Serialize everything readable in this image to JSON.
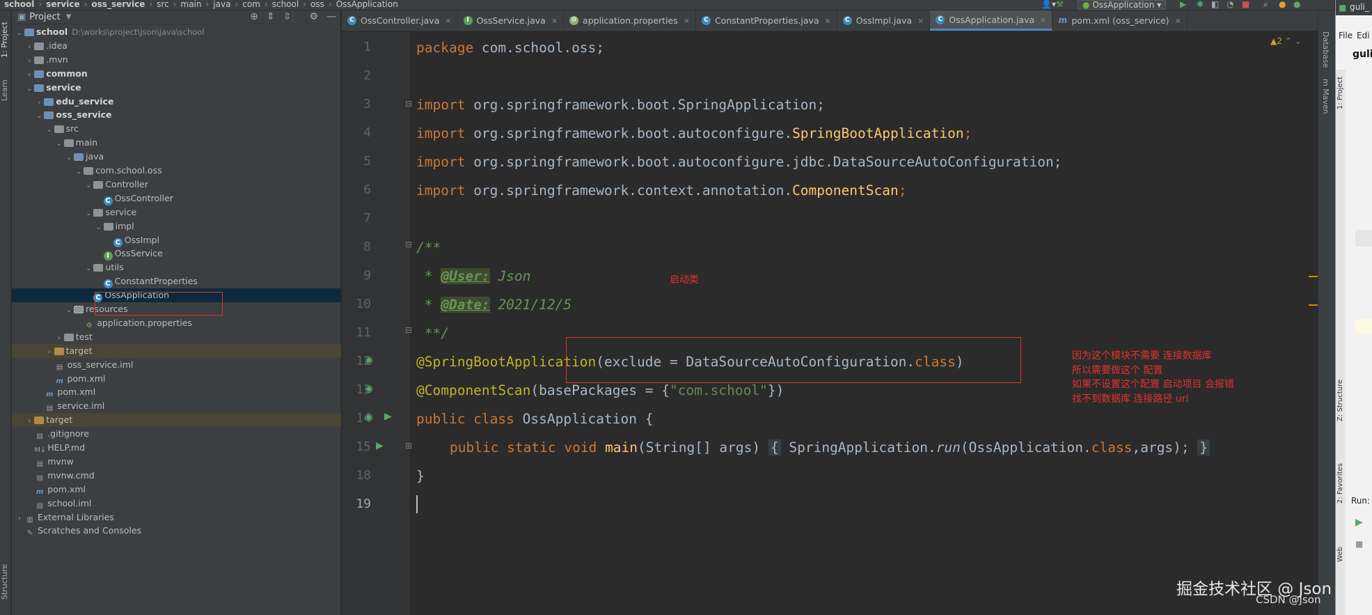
{
  "breadcrumb": [
    "school",
    "service",
    "oss_service",
    "src",
    "main",
    "java",
    "com",
    "school",
    "oss",
    "OssApplication"
  ],
  "run_config": {
    "label": "OssApplication"
  },
  "left_strip": {
    "project": "1: Project",
    "learn": "Learn",
    "structure": "Structure"
  },
  "project_panel": {
    "title": "Project",
    "tree": [
      {
        "label": "school",
        "suffix": "D:\\works\\project\\json\\java\\school",
        "depth": 0,
        "arrow": "down",
        "icon": "folder-blue",
        "bold": true
      },
      {
        "label": ".idea",
        "depth": 1,
        "arrow": "right",
        "icon": "folder"
      },
      {
        "label": ".mvn",
        "depth": 1,
        "arrow": "right",
        "icon": "folder"
      },
      {
        "label": "common",
        "depth": 1,
        "arrow": "right",
        "icon": "folder-blue",
        "bold": true
      },
      {
        "label": "service",
        "depth": 1,
        "arrow": "down",
        "icon": "folder-blue",
        "bold": true
      },
      {
        "label": "edu_service",
        "depth": 2,
        "arrow": "right",
        "icon": "folder-blue",
        "bold": true
      },
      {
        "label": "oss_service",
        "depth": 2,
        "arrow": "down",
        "icon": "folder-blue",
        "bold": true
      },
      {
        "label": "src",
        "depth": 3,
        "arrow": "down",
        "icon": "folder"
      },
      {
        "label": "main",
        "depth": 4,
        "arrow": "down",
        "icon": "folder"
      },
      {
        "label": "java",
        "depth": 5,
        "arrow": "down",
        "icon": "folder-blue"
      },
      {
        "label": "com.school.oss",
        "depth": 6,
        "arrow": "down",
        "icon": "folder"
      },
      {
        "label": "Controller",
        "depth": 7,
        "arrow": "down",
        "icon": "folder"
      },
      {
        "label": "OssController",
        "depth": 8,
        "arrow": "",
        "icon": "class"
      },
      {
        "label": "service",
        "depth": 7,
        "arrow": "down",
        "icon": "folder"
      },
      {
        "label": "impl",
        "depth": 8,
        "arrow": "down",
        "icon": "folder"
      },
      {
        "label": "OssImpl",
        "depth": 9,
        "arrow": "",
        "icon": "class"
      },
      {
        "label": "OssService",
        "depth": 8,
        "arrow": "",
        "icon": "interface"
      },
      {
        "label": "utils",
        "depth": 7,
        "arrow": "down",
        "icon": "folder"
      },
      {
        "label": "ConstantProperties",
        "depth": 8,
        "arrow": "",
        "icon": "class"
      },
      {
        "label": "OssApplication",
        "depth": 7,
        "arrow": "",
        "icon": "spring-class",
        "selected": true
      },
      {
        "label": "resources",
        "depth": 5,
        "arrow": "down",
        "icon": "folder-res"
      },
      {
        "label": "application.properties",
        "depth": 6,
        "arrow": "",
        "icon": "properties"
      },
      {
        "label": "test",
        "depth": 4,
        "arrow": "right",
        "icon": "folder"
      },
      {
        "label": "target",
        "depth": 3,
        "arrow": "right",
        "icon": "folder-orange",
        "target": true
      },
      {
        "label": "oss_service.iml",
        "depth": 3,
        "arrow": "",
        "icon": "file"
      },
      {
        "label": "pom.xml",
        "depth": 3,
        "arrow": "",
        "icon": "maven"
      },
      {
        "label": "pom.xml",
        "depth": 2,
        "arrow": "",
        "icon": "maven"
      },
      {
        "label": "service.iml",
        "depth": 2,
        "arrow": "",
        "icon": "file"
      },
      {
        "label": "target",
        "depth": 1,
        "arrow": "right",
        "icon": "folder-orange",
        "target": true
      },
      {
        "label": ".gitignore",
        "depth": 1,
        "arrow": "",
        "icon": "file"
      },
      {
        "label": "HELP.md",
        "depth": 1,
        "arrow": "",
        "icon": "md"
      },
      {
        "label": "mvnw",
        "depth": 1,
        "arrow": "",
        "icon": "file"
      },
      {
        "label": "mvnw.cmd",
        "depth": 1,
        "arrow": "",
        "icon": "file"
      },
      {
        "label": "pom.xml",
        "depth": 1,
        "arrow": "",
        "icon": "maven"
      },
      {
        "label": "school.iml",
        "depth": 1,
        "arrow": "",
        "icon": "file"
      },
      {
        "label": "External Libraries",
        "depth": 0,
        "arrow": "right",
        "icon": "libs"
      },
      {
        "label": "Scratches and Consoles",
        "depth": 0,
        "arrow": "",
        "icon": "scratch"
      }
    ]
  },
  "tabs": [
    {
      "label": "OssController.java",
      "icon": "class"
    },
    {
      "label": "OssService.java",
      "icon": "interface"
    },
    {
      "label": "application.properties",
      "icon": "properties"
    },
    {
      "label": "ConstantProperties.java",
      "icon": "class"
    },
    {
      "label": "OssImpl.java",
      "icon": "class"
    },
    {
      "label": "OssApplication.java",
      "icon": "class",
      "active": true
    },
    {
      "label": "pom.xml (oss_service)",
      "icon": "maven"
    }
  ],
  "editor": {
    "warnings": "▲2",
    "line_numbers": [
      "1",
      "2",
      "3",
      "4",
      "5",
      "6",
      "7",
      "8",
      "9",
      "10",
      "11",
      "12",
      "13",
      "14",
      "15",
      "18",
      "19"
    ],
    "code": {
      "l1_kw": "package",
      "l1_rest": " com.school.oss;",
      "import": "import",
      "l3": " org.springframework.boot.SpringApplication;",
      "l4_a": " org.springframework.boot.autoconfigure.",
      "l4_b": "SpringBootApplication",
      "l4_c": ";",
      "l5": " org.springframework.boot.autoconfigure.jdbc.DataSourceAutoConfiguration;",
      "l6_a": " org.springframework.context.annotation.",
      "l6_b": "ComponentScan",
      "l6_c": ";",
      "l8": "/**",
      "l9_star": " * ",
      "l9_tag": "@User:",
      "l9_val": " Json",
      "l10_star": " * ",
      "l10_tag": "@Date:",
      "l10_val": " 2021/12/5",
      "l11": " **/",
      "l12_ann": "@SpringBootApplication",
      "l12_a": "(exclude = DataSourceAutoConfiguration.",
      "l12_kw": "class",
      "l12_b": ")",
      "l13_ann": "@ComponentScan",
      "l13_a": "(basePackages = {",
      "l13_str": "\"com.school\"",
      "l13_b": "})",
      "l14_kw": "public class",
      "l14_rest": " OssApplication {",
      "l15_kw": "public static void",
      "l15_fn": " main",
      "l15_a": "(String[] args) ",
      "l15_ob": "{",
      "l15_b": " SpringApplication.",
      "l15_run": "run",
      "l15_c": "(OssApplication.",
      "l15_kw2": "class",
      "l15_d": ",args); ",
      "l15_cb": "}",
      "l18": "}"
    }
  },
  "annotations": {
    "startup_class": "启动类",
    "explanation": [
      "因为这个模块不需要 连接数据库",
      "所以需要做这个 配置",
      "如果不设置这个配置  启动项目 会报错",
      "找不到数据库 连接路径 url"
    ]
  },
  "right_strip": {
    "database": "Database",
    "maven": "m Maven"
  },
  "outer_window": {
    "title": "guli_",
    "menu_edit": "Edi",
    "menu_file": "File",
    "project_label": "1: Project",
    "structure_label": "Z: Structure",
    "favorites_label": "2: Favorites",
    "web_label": "Web",
    "run_label": "Run:"
  },
  "watermark": {
    "juejin": "掘金技术社区 @ Json",
    "csdn": "CSDN @Json"
  },
  "colors": {
    "keyword": "#cc7832",
    "annotation": "#bbb529",
    "string": "#6a8759",
    "function": "#ffc66d",
    "doc": "#629755",
    "highlight_box": "#e0332d"
  }
}
